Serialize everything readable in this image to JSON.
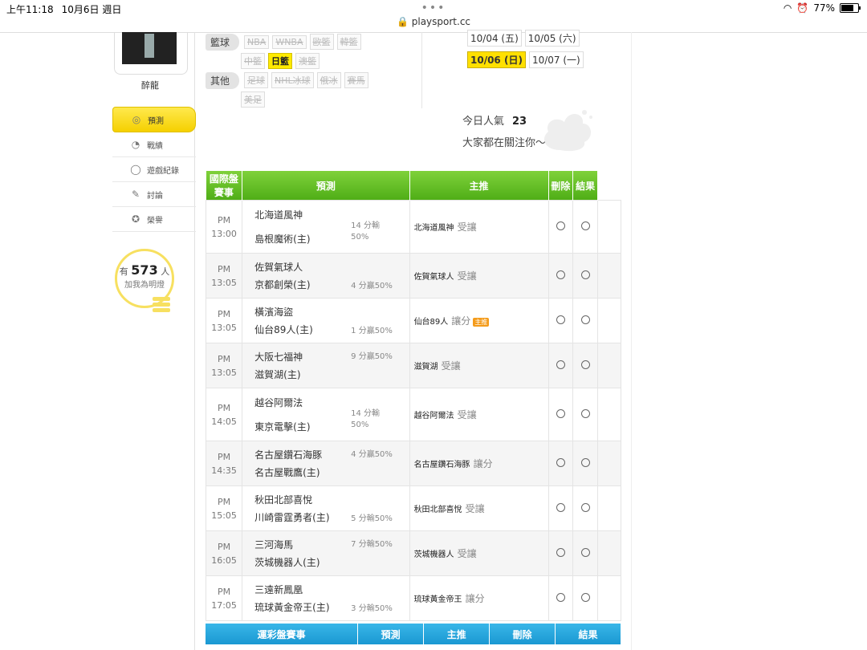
{
  "status_bar": {
    "time": "上午11:18",
    "date": "10月6日 週日",
    "battery": "77%",
    "battery_level": 0.77
  },
  "browser": {
    "url": "playsport.cc"
  },
  "profile": {
    "username": "醉龍"
  },
  "nav": [
    {
      "label": "預測",
      "icon": "crosshair-icon",
      "glyph": "◎",
      "active": true
    },
    {
      "label": "戰績",
      "icon": "chart-icon",
      "glyph": "◔",
      "active": false
    },
    {
      "label": "遊戲紀錄",
      "icon": "ring-icon",
      "glyph": "◯",
      "active": false
    },
    {
      "label": "討論",
      "icon": "chat-icon",
      "glyph": "✎",
      "active": false
    },
    {
      "label": "榮譽",
      "icon": "medal-icon",
      "glyph": "✪",
      "active": false
    }
  ],
  "lightbulb": {
    "prefix": "有",
    "count": "573",
    "suffix": "人",
    "text": "加我為明燈"
  },
  "filters": [
    {
      "category": "籃球",
      "tags": [
        {
          "label": "NBA",
          "active": false
        },
        {
          "label": "WNBA",
          "active": false
        },
        {
          "label": "歐籃",
          "active": false
        },
        {
          "label": "韓籃",
          "active": false
        }
      ]
    },
    {
      "category": "",
      "tags": [
        {
          "label": "中籃",
          "active": false
        },
        {
          "label": "日籃",
          "active": true
        },
        {
          "label": "澳籃",
          "active": false
        }
      ]
    },
    {
      "category": "其他",
      "tags": [
        {
          "label": "足球",
          "active": false
        },
        {
          "label": "NHL冰球",
          "active": false
        },
        {
          "label": "俄冰",
          "active": false
        },
        {
          "label": "賽馬",
          "active": false
        }
      ]
    },
    {
      "category": "",
      "tags": [
        {
          "label": "美足",
          "active": false
        }
      ]
    }
  ],
  "dates": [
    [
      {
        "label": "10/04 (五)",
        "active": false
      },
      {
        "label": "10/05 (六)",
        "active": false
      }
    ],
    [
      {
        "label": "10/06 (日)",
        "active": true
      },
      {
        "label": "10/07 (一)",
        "active": false
      }
    ]
  ],
  "popularity": {
    "label": "今日人氣",
    "value": "23",
    "follow_text": "大家都在關注你～"
  },
  "table_intl": {
    "headers": [
      "國際盤賽事",
      "預測",
      "主推",
      "刪除",
      "結果"
    ],
    "rows": [
      {
        "ampm": "PM",
        "time": "13:00",
        "away": "北海道風神",
        "home": "島根魔術(主)",
        "odds": "14 分輸 50%",
        "odds_pos": "mid",
        "pick": "北海道風神",
        "result": "受讓",
        "badge": ""
      },
      {
        "ampm": "PM",
        "time": "13:05",
        "away": "佐賀氣球人",
        "home": "京都創榮(主)",
        "odds": "4 分贏50%",
        "odds_pos": "bottom",
        "pick": "佐賀氣球人",
        "result": "受讓",
        "badge": ""
      },
      {
        "ampm": "PM",
        "time": "13:05",
        "away": "橫濱海盜",
        "home": "仙台89人(主)",
        "odds": "1 分贏50%",
        "odds_pos": "bottom",
        "pick": "仙台89人",
        "result": "讓分",
        "badge": "主推"
      },
      {
        "ampm": "PM",
        "time": "13:05",
        "away": "大阪七福神",
        "home": "滋賀湖(主)",
        "odds": "9 分贏50%",
        "odds_pos": "top",
        "pick": "滋賀湖",
        "result": "受讓",
        "badge": ""
      },
      {
        "ampm": "PM",
        "time": "14:05",
        "away": "越谷阿爾法",
        "home": "東京電擊(主)",
        "odds": "14 分輸 50%",
        "odds_pos": "mid",
        "pick": "越谷阿爾法",
        "result": "受讓",
        "badge": ""
      },
      {
        "ampm": "PM",
        "time": "14:35",
        "away": "名古屋鑽石海豚",
        "home": "名古屋戰鷹(主)",
        "odds": "4 分贏50%",
        "odds_pos": "top",
        "pick": "名古屋鑽石海豚",
        "result": "讓分",
        "badge": ""
      },
      {
        "ampm": "PM",
        "time": "15:05",
        "away": "秋田北部喜悅",
        "home": "川崎雷霆勇者(主)",
        "odds": "5 分輸50%",
        "odds_pos": "bottom",
        "pick": "秋田北部喜悅",
        "result": "受讓",
        "badge": ""
      },
      {
        "ampm": "PM",
        "time": "16:05",
        "away": "三河海馬",
        "home": "茨城機器人(主)",
        "odds": "7 分輸50%",
        "odds_pos": "top",
        "pick": "茨城機器人",
        "result": "受讓",
        "badge": ""
      },
      {
        "ampm": "PM",
        "time": "17:05",
        "away": "三遠新鳳凰",
        "home": "琉球黃金帝王(主)",
        "odds": "3 分輸50%",
        "odds_pos": "bottom",
        "pick": "琉球黃金帝王",
        "result": "讓分",
        "badge": ""
      }
    ]
  },
  "table_lottery": {
    "headers": [
      "運彩盤賽事",
      "預測",
      "主推",
      "刪除",
      "結果"
    ]
  }
}
